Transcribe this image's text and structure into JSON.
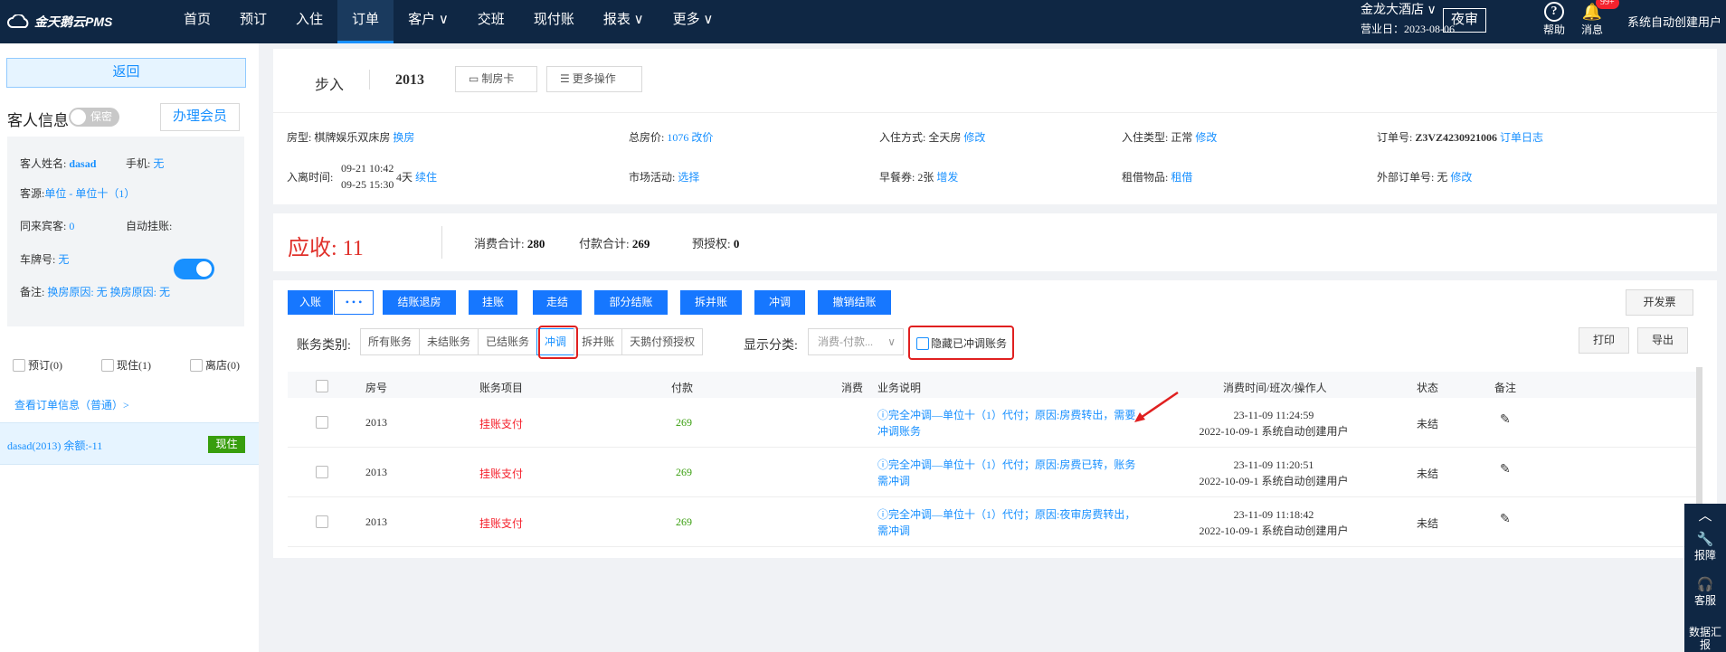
{
  "topbar": {
    "logo": "金天鹅云PMS",
    "nav": [
      "首页",
      "预订",
      "入住",
      "订单",
      "客户 ∨",
      "交班",
      "现付账",
      "报表 ∨",
      "更多 ∨"
    ],
    "active_index": 3,
    "hotel": "金龙大酒店 ∨",
    "biz_date": "营业日：2023-08-06",
    "night_audit": "夜审",
    "help": "帮助",
    "messages": "消息",
    "msg_badge": "99+",
    "user": "系统自动创建用户"
  },
  "sidebar": {
    "back": "返回",
    "guest_title": "客人信息",
    "secret_toggle": "保密",
    "member_btn": "办理会员",
    "guest_name_label": "客人姓名:",
    "guest_name": "dasad",
    "phone_label": "手机:",
    "phone": "无",
    "source_label": "客源:",
    "source": "单位  - 单位十（1）",
    "companions_label": "同来宾客:",
    "companions": "0",
    "auto_charge_label": "自动挂账:",
    "plate_label": "车牌号:",
    "plate": "无",
    "remark_label": "备注:",
    "remark": "换房原因: 无 换房原因: 无",
    "status_cbs": [
      "预订(0)",
      "现住(1)",
      "离店(0)"
    ],
    "order_link": "查看订单信息（普通）>",
    "order_item": "dasad(2013)    余额:-11",
    "order_tag": "现住"
  },
  "header": {
    "walkin": "步入",
    "room": "2013",
    "make_card": "制房卡",
    "more_ops": "更多操作"
  },
  "fields": {
    "room_type_label": "房型:",
    "room_type": "棋牌娱乐双床房",
    "change_room": "换房",
    "total_label": "总房价:",
    "total": "1076",
    "change_price": "改价",
    "checkin_mode_label": "入住方式:",
    "checkin_mode": "全天房",
    "edit1": "修改",
    "checkin_type_label": "入住类型:",
    "checkin_type": "正常",
    "edit2": "修改",
    "order_no_label": "订单号:",
    "order_no": "Z3VZ4230921006",
    "order_log": "订单日志",
    "stay_label": "入离时间:",
    "stay_in": "09-21 10:42",
    "stay_out": "09-25 15:30",
    "nights": "4天",
    "extend": "续住",
    "market_label": "市场活动:",
    "market": "选择",
    "breakfast_label": "早餐券:",
    "breakfast": "2张",
    "add": "增发",
    "rent_label": "租借物品:",
    "rent": "租借",
    "ext_order_label": "外部订单号:",
    "ext_order": "无",
    "edit3": "修改"
  },
  "summary": {
    "due_label": "应收:",
    "due": "11",
    "consume_label": "消费合计:",
    "consume": "280",
    "pay_label": "付款合计:",
    "pay": "269",
    "preauth_label": "预授权:",
    "preauth": "0"
  },
  "actions": {
    "post": "入账",
    "more": "• • •",
    "checkout_room": "结账退房",
    "charge": "挂账",
    "walkout": "走结",
    "partial": "部分结账",
    "split": "拆并账",
    "reverse": "冲调",
    "cancel_checkout": "撤销结账",
    "invoice": "开发票",
    "print": "打印",
    "export": "导出"
  },
  "filters": {
    "label": "账务类别:",
    "tabs": [
      "所有账务",
      "未结账务",
      "已结账务",
      "冲调",
      "拆并账",
      "天鹅付预授权"
    ],
    "active_tab": 3,
    "display_label": "显示分类:",
    "display_value": "消费-付款...",
    "hide_reversed": "隐藏已冲调账务"
  },
  "table": {
    "headers": [
      "房号",
      "账务项目",
      "付款",
      "消费",
      "业务说明",
      "消费时间/班次/操作人",
      "状态",
      "备注"
    ],
    "rows": [
      {
        "room": "2013",
        "item": "挂账支付",
        "payment": "269",
        "consume": "",
        "desc": "完全冲调—单位十（1）代付；原因:房费转出，需要冲调账务",
        "time": "23-11-09 11:24:59",
        "shift": "2022-10-09-1 系统自动创建用户",
        "status": "未结"
      },
      {
        "room": "2013",
        "item": "挂账支付",
        "payment": "269",
        "consume": "",
        "desc": "完全冲调—单位十（1）代付；原因:房费已转，账务需冲调",
        "time": "23-11-09 11:20:51",
        "shift": "2022-10-09-1 系统自动创建用户",
        "status": "未结"
      },
      {
        "room": "2013",
        "item": "挂账支付",
        "payment": "269",
        "consume": "",
        "desc": "完全冲调—单位十（1）代付；原因:夜审房费转出，需冲调",
        "time": "23-11-09 11:18:42",
        "shift": "2022-10-09-1 系统自动创建用户",
        "status": "未结"
      }
    ]
  },
  "float": {
    "report": "报障",
    "service": "客服",
    "data_report": "数据汇报"
  },
  "colors": {
    "topbar": "#0f2744",
    "primary": "#1677ff",
    "danger": "#f5222d",
    "success": "#389e0d",
    "annotation": "#e02020"
  }
}
